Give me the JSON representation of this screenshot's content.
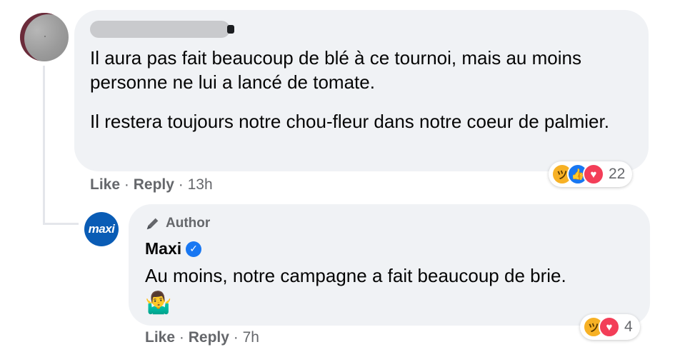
{
  "comment": {
    "paragraphs": [
      "Il aura pas fait beaucoup de blé à ce tournoi, mais au moins personne ne lui a lancé de tomate.",
      "Il restera toujours notre chou-fleur dans notre coeur de palmier."
    ],
    "actions": {
      "like": "Like",
      "reply": "Reply",
      "separator": "·",
      "time": "13h"
    },
    "reactions": {
      "types": [
        "haha",
        "like",
        "love"
      ],
      "count": "22"
    }
  },
  "reply": {
    "author_badge": "Author",
    "name": "Maxi",
    "avatar_text": "maxi",
    "text": "Au moins, notre campagne a fait beaucoup de brie.",
    "emoji": "🤷‍♂️",
    "actions": {
      "like": "Like",
      "reply": "Reply",
      "separator": "·",
      "time": "7h"
    },
    "reactions": {
      "types": [
        "haha",
        "love"
      ],
      "count": "4"
    }
  },
  "icons": {
    "pen": "pen-icon",
    "verified": "verified-badge-icon",
    "haha": "haha-reaction-icon",
    "like": "like-reaction-icon",
    "love": "love-reaction-icon"
  },
  "colors": {
    "bubble": "#f0f2f5",
    "meta_text": "#65676b",
    "like_blue": "#1877f2",
    "love_red": "#f33e58",
    "haha_yellow": "#f7b125",
    "maxi_blue": "#0a5cb5"
  }
}
